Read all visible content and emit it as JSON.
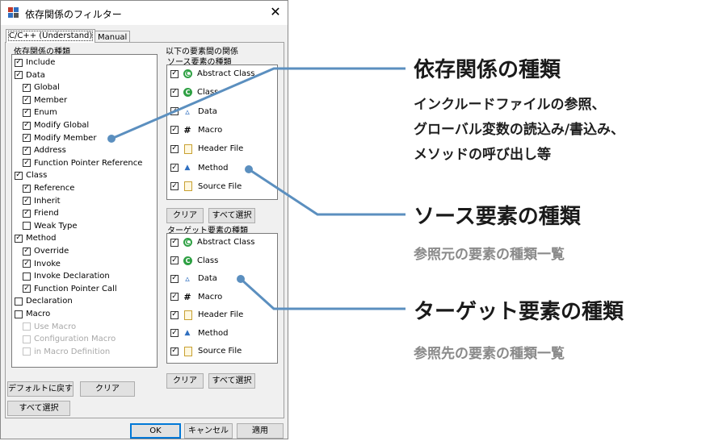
{
  "dialog": {
    "title": "依存関係のフィルター",
    "tabs": [
      {
        "label": "C/C++ (Understand)",
        "active": true
      },
      {
        "label": "Manual",
        "active": false
      }
    ],
    "dep_kinds": {
      "label": "依存関係の種類",
      "items": [
        {
          "label": "Include",
          "checked": true,
          "disabled": false,
          "indent": 0
        },
        {
          "label": "Data",
          "checked": true,
          "disabled": false,
          "indent": 0
        },
        {
          "label": "Global",
          "checked": true,
          "disabled": false,
          "indent": 1
        },
        {
          "label": "Member",
          "checked": true,
          "disabled": false,
          "indent": 1
        },
        {
          "label": "Enum",
          "checked": true,
          "disabled": false,
          "indent": 1
        },
        {
          "label": "Modify Global",
          "checked": true,
          "disabled": false,
          "indent": 1
        },
        {
          "label": "Modify Member",
          "checked": true,
          "disabled": false,
          "indent": 1
        },
        {
          "label": "Address",
          "checked": true,
          "disabled": false,
          "indent": 1
        },
        {
          "label": "Function Pointer Reference",
          "checked": true,
          "disabled": false,
          "indent": 1
        },
        {
          "label": "Class",
          "checked": true,
          "disabled": false,
          "indent": 0
        },
        {
          "label": "Reference",
          "checked": true,
          "disabled": false,
          "indent": 1
        },
        {
          "label": "Inherit",
          "checked": true,
          "disabled": false,
          "indent": 1
        },
        {
          "label": "Friend",
          "checked": true,
          "disabled": false,
          "indent": 1
        },
        {
          "label": "Weak Type",
          "checked": false,
          "disabled": false,
          "indent": 1
        },
        {
          "label": "Method",
          "checked": true,
          "disabled": false,
          "indent": 0
        },
        {
          "label": "Override",
          "checked": true,
          "disabled": false,
          "indent": 1
        },
        {
          "label": "Invoke",
          "checked": true,
          "disabled": false,
          "indent": 1
        },
        {
          "label": "Invoke Declaration",
          "checked": false,
          "disabled": false,
          "indent": 1
        },
        {
          "label": "Function Pointer Call",
          "checked": true,
          "disabled": false,
          "indent": 1
        },
        {
          "label": "Declaration",
          "checked": false,
          "disabled": false,
          "indent": 0
        },
        {
          "label": "Macro",
          "checked": false,
          "disabled": false,
          "indent": 0
        },
        {
          "label": "Use Macro",
          "checked": false,
          "disabled": true,
          "indent": 1
        },
        {
          "label": "Configuration Macro",
          "checked": false,
          "disabled": true,
          "indent": 1
        },
        {
          "label": "in Macro Definition",
          "checked": false,
          "disabled": true,
          "indent": 1
        }
      ]
    },
    "relation_label": "以下の要素間の関係",
    "source_kinds": {
      "label": "ソース要素の種類",
      "items": [
        {
          "label": "Abstract Class",
          "icon": "abstract-class-icon",
          "checked": true
        },
        {
          "label": "Class",
          "icon": "class-icon",
          "checked": true
        },
        {
          "label": "Data",
          "icon": "data-icon",
          "checked": true
        },
        {
          "label": "Macro",
          "icon": "macro-icon",
          "checked": true
        },
        {
          "label": "Header File",
          "icon": "header-file-icon",
          "checked": true
        },
        {
          "label": "Method",
          "icon": "method-icon",
          "checked": true
        },
        {
          "label": "Source File",
          "icon": "source-file-icon",
          "checked": true
        }
      ]
    },
    "target_kinds": {
      "label": "ターゲット要素の種類",
      "items": [
        {
          "label": "Abstract Class",
          "icon": "abstract-class-icon",
          "checked": true
        },
        {
          "label": "Class",
          "icon": "class-icon",
          "checked": true
        },
        {
          "label": "Data",
          "icon": "data-icon",
          "checked": true
        },
        {
          "label": "Macro",
          "icon": "macro-icon",
          "checked": true
        },
        {
          "label": "Header File",
          "icon": "header-file-icon",
          "checked": true
        },
        {
          "label": "Method",
          "icon": "method-icon",
          "checked": true
        },
        {
          "label": "Source File",
          "icon": "source-file-icon",
          "checked": true
        }
      ]
    },
    "buttons": {
      "default_reset": "デフォルトに戻す",
      "clear": "クリア",
      "select_all": "すべて選択",
      "ok": "OK",
      "cancel": "キャンセル",
      "apply": "適用"
    }
  },
  "callouts": {
    "dep": {
      "title": "依存関係の種類",
      "desc": [
        "インクルードファイルの参照、",
        "グローバル変数の読込み/書込み、",
        "メソッドの呼び出し等"
      ]
    },
    "source": {
      "title": "ソース要素の種類",
      "desc": "参照元の要素の種類一覧"
    },
    "target": {
      "title": "ターゲット要素の種類",
      "desc": "参照先の要素の種類一覧"
    }
  },
  "colors": {
    "callout_line": "#5b8fbf",
    "icon_green": "#2ea043",
    "icon_blue": "#2f6fc0"
  }
}
